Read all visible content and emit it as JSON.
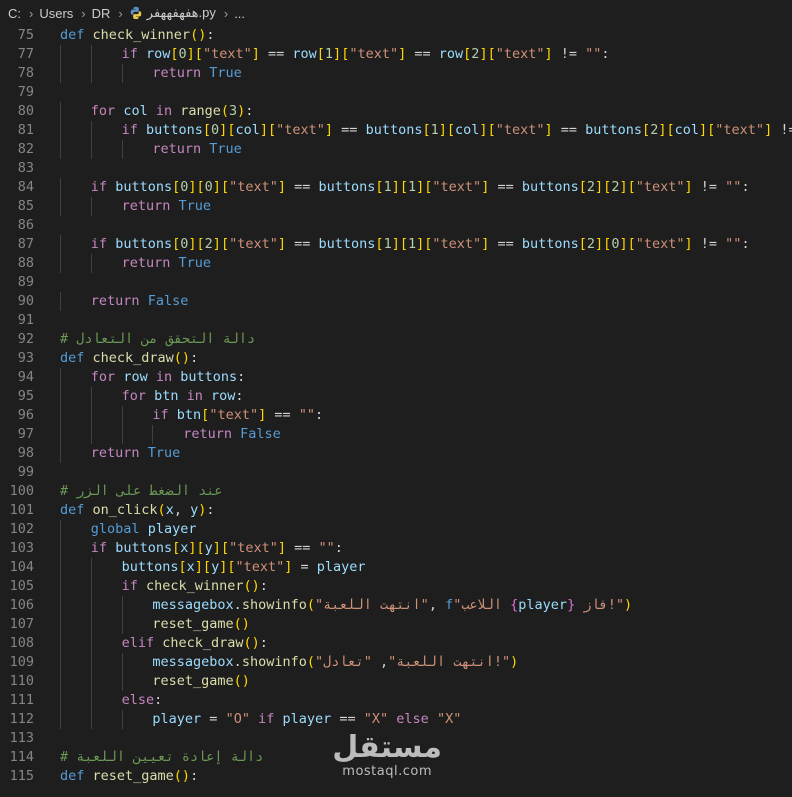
{
  "breadcrumb": {
    "items": [
      "C:",
      "Users",
      "DR"
    ],
    "file_icon": "python-file-icon",
    "file_name": "هفهفههفر.py",
    "trailing": "..."
  },
  "colors": {
    "background": "#1e1e1e",
    "keyword": "#569cd6",
    "control": "#c586c0",
    "function": "#dcdcaa",
    "variable": "#9cdcfe",
    "string": "#ce9178",
    "comment": "#6a9955",
    "line_number": "#858585"
  },
  "watermark": {
    "arabic": "مستقل",
    "latin": "mostaql.com"
  },
  "code_lines": [
    {
      "n": "75",
      "indent": 0,
      "tokens": [
        [
          "kw",
          "def "
        ],
        [
          "fn",
          "check_winner"
        ],
        [
          "b1",
          "()"
        ],
        [
          "p",
          ":"
        ]
      ]
    },
    {
      "n": "77",
      "indent": 2,
      "tokens": [
        [
          "ctl",
          "if "
        ],
        [
          "var",
          "row"
        ],
        [
          "b1",
          "["
        ],
        [
          "num",
          "0"
        ],
        [
          "b1",
          "]"
        ],
        [
          "b1",
          "["
        ],
        [
          "str",
          "\"text\""
        ],
        [
          "b1",
          "]"
        ],
        [
          "p",
          " == "
        ],
        [
          "var",
          "row"
        ],
        [
          "b1",
          "["
        ],
        [
          "num",
          "1"
        ],
        [
          "b1",
          "]"
        ],
        [
          "b1",
          "["
        ],
        [
          "str",
          "\"text\""
        ],
        [
          "b1",
          "]"
        ],
        [
          "p",
          " == "
        ],
        [
          "var",
          "row"
        ],
        [
          "b1",
          "["
        ],
        [
          "num",
          "2"
        ],
        [
          "b1",
          "]"
        ],
        [
          "b1",
          "["
        ],
        [
          "str",
          "\"text\""
        ],
        [
          "b1",
          "]"
        ],
        [
          "p",
          " != "
        ],
        [
          "str",
          "\"\""
        ],
        [
          "p",
          ":"
        ]
      ]
    },
    {
      "n": "78",
      "indent": 3,
      "tokens": [
        [
          "ctl",
          "return "
        ],
        [
          "kw",
          "True"
        ]
      ]
    },
    {
      "n": "79",
      "indent": 0,
      "tokens": []
    },
    {
      "n": "80",
      "indent": 1,
      "tokens": [
        [
          "ctl",
          "for "
        ],
        [
          "var",
          "col"
        ],
        [
          "ctl",
          " in "
        ],
        [
          "fn",
          "range"
        ],
        [
          "b1",
          "("
        ],
        [
          "num",
          "3"
        ],
        [
          "b1",
          ")"
        ],
        [
          "p",
          ":"
        ]
      ]
    },
    {
      "n": "81",
      "indent": 2,
      "tokens": [
        [
          "ctl",
          "if "
        ],
        [
          "var",
          "buttons"
        ],
        [
          "b1",
          "["
        ],
        [
          "num",
          "0"
        ],
        [
          "b1",
          "]"
        ],
        [
          "b1",
          "["
        ],
        [
          "var",
          "col"
        ],
        [
          "b1",
          "]"
        ],
        [
          "b1",
          "["
        ],
        [
          "str",
          "\"text\""
        ],
        [
          "b1",
          "]"
        ],
        [
          "p",
          " == "
        ],
        [
          "var",
          "buttons"
        ],
        [
          "b1",
          "["
        ],
        [
          "num",
          "1"
        ],
        [
          "b1",
          "]"
        ],
        [
          "b1",
          "["
        ],
        [
          "var",
          "col"
        ],
        [
          "b1",
          "]"
        ],
        [
          "b1",
          "["
        ],
        [
          "str",
          "\"text\""
        ],
        [
          "b1",
          "]"
        ],
        [
          "p",
          " == "
        ],
        [
          "var",
          "buttons"
        ],
        [
          "b1",
          "["
        ],
        [
          "num",
          "2"
        ],
        [
          "b1",
          "]"
        ],
        [
          "b1",
          "["
        ],
        [
          "var",
          "col"
        ],
        [
          "b1",
          "]"
        ],
        [
          "b1",
          "["
        ],
        [
          "str",
          "\"text\""
        ],
        [
          "b1",
          "]"
        ],
        [
          "p",
          " != "
        ],
        [
          "str",
          "\"\""
        ],
        [
          "p",
          ":"
        ]
      ]
    },
    {
      "n": "82",
      "indent": 3,
      "tokens": [
        [
          "ctl",
          "return "
        ],
        [
          "kw",
          "True"
        ]
      ]
    },
    {
      "n": "83",
      "indent": 0,
      "tokens": []
    },
    {
      "n": "84",
      "indent": 1,
      "tokens": [
        [
          "ctl",
          "if "
        ],
        [
          "var",
          "buttons"
        ],
        [
          "b1",
          "["
        ],
        [
          "num",
          "0"
        ],
        [
          "b1",
          "]"
        ],
        [
          "b1",
          "["
        ],
        [
          "num",
          "0"
        ],
        [
          "b1",
          "]"
        ],
        [
          "b1",
          "["
        ],
        [
          "str",
          "\"text\""
        ],
        [
          "b1",
          "]"
        ],
        [
          "p",
          " == "
        ],
        [
          "var",
          "buttons"
        ],
        [
          "b1",
          "["
        ],
        [
          "num",
          "1"
        ],
        [
          "b1",
          "]"
        ],
        [
          "b1",
          "["
        ],
        [
          "num",
          "1"
        ],
        [
          "b1",
          "]"
        ],
        [
          "b1",
          "["
        ],
        [
          "str",
          "\"text\""
        ],
        [
          "b1",
          "]"
        ],
        [
          "p",
          " == "
        ],
        [
          "var",
          "buttons"
        ],
        [
          "b1",
          "["
        ],
        [
          "num",
          "2"
        ],
        [
          "b1",
          "]"
        ],
        [
          "b1",
          "["
        ],
        [
          "num",
          "2"
        ],
        [
          "b1",
          "]"
        ],
        [
          "b1",
          "["
        ],
        [
          "str",
          "\"text\""
        ],
        [
          "b1",
          "]"
        ],
        [
          "p",
          " != "
        ],
        [
          "str",
          "\"\""
        ],
        [
          "p",
          ":"
        ]
      ]
    },
    {
      "n": "85",
      "indent": 2,
      "tokens": [
        [
          "ctl",
          "return "
        ],
        [
          "kw",
          "True"
        ]
      ]
    },
    {
      "n": "86",
      "indent": 0,
      "tokens": []
    },
    {
      "n": "87",
      "indent": 1,
      "tokens": [
        [
          "ctl",
          "if "
        ],
        [
          "var",
          "buttons"
        ],
        [
          "b1",
          "["
        ],
        [
          "num",
          "0"
        ],
        [
          "b1",
          "]"
        ],
        [
          "b1",
          "["
        ],
        [
          "num",
          "2"
        ],
        [
          "b1",
          "]"
        ],
        [
          "b1",
          "["
        ],
        [
          "str",
          "\"text\""
        ],
        [
          "b1",
          "]"
        ],
        [
          "p",
          " == "
        ],
        [
          "var",
          "buttons"
        ],
        [
          "b1",
          "["
        ],
        [
          "num",
          "1"
        ],
        [
          "b1",
          "]"
        ],
        [
          "b1",
          "["
        ],
        [
          "num",
          "1"
        ],
        [
          "b1",
          "]"
        ],
        [
          "b1",
          "["
        ],
        [
          "str",
          "\"text\""
        ],
        [
          "b1",
          "]"
        ],
        [
          "p",
          " == "
        ],
        [
          "var",
          "buttons"
        ],
        [
          "b1",
          "["
        ],
        [
          "num",
          "2"
        ],
        [
          "b1",
          "]"
        ],
        [
          "b1",
          "["
        ],
        [
          "num",
          "0"
        ],
        [
          "b1",
          "]"
        ],
        [
          "b1",
          "["
        ],
        [
          "str",
          "\"text\""
        ],
        [
          "b1",
          "]"
        ],
        [
          "p",
          " != "
        ],
        [
          "str",
          "\"\""
        ],
        [
          "p",
          ":"
        ]
      ]
    },
    {
      "n": "88",
      "indent": 2,
      "tokens": [
        [
          "ctl",
          "return "
        ],
        [
          "kw",
          "True"
        ]
      ]
    },
    {
      "n": "89",
      "indent": 0,
      "tokens": []
    },
    {
      "n": "90",
      "indent": 1,
      "tokens": [
        [
          "ctl",
          "return "
        ],
        [
          "kw",
          "False"
        ]
      ]
    },
    {
      "n": "91",
      "indent": 0,
      "tokens": []
    },
    {
      "n": "92",
      "indent": 0,
      "tokens": [
        [
          "cm",
          "# دالة التحقق من التعادل"
        ]
      ]
    },
    {
      "n": "93",
      "indent": 0,
      "tokens": [
        [
          "kw",
          "def "
        ],
        [
          "fn",
          "check_draw"
        ],
        [
          "b1",
          "()"
        ],
        [
          "p",
          ":"
        ]
      ]
    },
    {
      "n": "94",
      "indent": 1,
      "tokens": [
        [
          "ctl",
          "for "
        ],
        [
          "var",
          "row"
        ],
        [
          "ctl",
          " in "
        ],
        [
          "var",
          "buttons"
        ],
        [
          "p",
          ":"
        ]
      ]
    },
    {
      "n": "95",
      "indent": 2,
      "tokens": [
        [
          "ctl",
          "for "
        ],
        [
          "var",
          "btn"
        ],
        [
          "ctl",
          " in "
        ],
        [
          "var",
          "row"
        ],
        [
          "p",
          ":"
        ]
      ]
    },
    {
      "n": "96",
      "indent": 3,
      "tokens": [
        [
          "ctl",
          "if "
        ],
        [
          "var",
          "btn"
        ],
        [
          "b1",
          "["
        ],
        [
          "str",
          "\"text\""
        ],
        [
          "b1",
          "]"
        ],
        [
          "p",
          " == "
        ],
        [
          "str",
          "\"\""
        ],
        [
          "p",
          ":"
        ]
      ]
    },
    {
      "n": "97",
      "indent": 4,
      "tokens": [
        [
          "ctl",
          "return "
        ],
        [
          "kw",
          "False"
        ]
      ]
    },
    {
      "n": "98",
      "indent": 1,
      "tokens": [
        [
          "ctl",
          "return "
        ],
        [
          "kw",
          "True"
        ]
      ]
    },
    {
      "n": "99",
      "indent": 0,
      "tokens": []
    },
    {
      "n": "100",
      "indent": 0,
      "tokens": [
        [
          "cm",
          "# عند الضغط على الزر"
        ]
      ]
    },
    {
      "n": "101",
      "indent": 0,
      "tokens": [
        [
          "kw",
          "def "
        ],
        [
          "fn",
          "on_click"
        ],
        [
          "b1",
          "("
        ],
        [
          "var",
          "x"
        ],
        [
          "p",
          ", "
        ],
        [
          "var",
          "y"
        ],
        [
          "b1",
          ")"
        ],
        [
          "p",
          ":"
        ]
      ]
    },
    {
      "n": "102",
      "indent": 1,
      "tokens": [
        [
          "kw",
          "global "
        ],
        [
          "var",
          "player"
        ]
      ]
    },
    {
      "n": "103",
      "indent": 1,
      "tokens": [
        [
          "ctl",
          "if "
        ],
        [
          "var",
          "buttons"
        ],
        [
          "b1",
          "["
        ],
        [
          "var",
          "x"
        ],
        [
          "b1",
          "]"
        ],
        [
          "b1",
          "["
        ],
        [
          "var",
          "y"
        ],
        [
          "b1",
          "]"
        ],
        [
          "b1",
          "["
        ],
        [
          "str",
          "\"text\""
        ],
        [
          "b1",
          "]"
        ],
        [
          "p",
          " == "
        ],
        [
          "str",
          "\"\""
        ],
        [
          "p",
          ":"
        ]
      ]
    },
    {
      "n": "104",
      "indent": 2,
      "tokens": [
        [
          "var",
          "buttons"
        ],
        [
          "b1",
          "["
        ],
        [
          "var",
          "x"
        ],
        [
          "b1",
          "]"
        ],
        [
          "b1",
          "["
        ],
        [
          "var",
          "y"
        ],
        [
          "b1",
          "]"
        ],
        [
          "b1",
          "["
        ],
        [
          "str",
          "\"text\""
        ],
        [
          "b1",
          "]"
        ],
        [
          "p",
          " = "
        ],
        [
          "var",
          "player"
        ]
      ]
    },
    {
      "n": "105",
      "indent": 2,
      "tokens": [
        [
          "ctl",
          "if "
        ],
        [
          "fn",
          "check_winner"
        ],
        [
          "b1",
          "()"
        ],
        [
          "p",
          ":"
        ]
      ]
    },
    {
      "n": "106",
      "indent": 3,
      "tokens": [
        [
          "var",
          "messagebox"
        ],
        [
          "p",
          "."
        ],
        [
          "fn",
          "showinfo"
        ],
        [
          "b1",
          "("
        ],
        [
          "str",
          "\"انتهت اللعبة\""
        ],
        [
          "p",
          ", "
        ],
        [
          "kw",
          "f"
        ],
        [
          "str",
          "\"اللاعب "
        ],
        [
          "b2",
          "{"
        ],
        [
          "var",
          "player"
        ],
        [
          "b2",
          "}"
        ],
        [
          "str",
          " فاز!\""
        ],
        [
          "b1",
          ")"
        ]
      ]
    },
    {
      "n": "107",
      "indent": 3,
      "tokens": [
        [
          "fn",
          "reset_game"
        ],
        [
          "b1",
          "()"
        ]
      ]
    },
    {
      "n": "108",
      "indent": 2,
      "tokens": [
        [
          "ctl",
          "elif "
        ],
        [
          "fn",
          "check_draw"
        ],
        [
          "b1",
          "()"
        ],
        [
          "p",
          ":"
        ]
      ]
    },
    {
      "n": "109",
      "indent": 3,
      "tokens": [
        [
          "var",
          "messagebox"
        ],
        [
          "p",
          "."
        ],
        [
          "fn",
          "showinfo"
        ],
        [
          "b1",
          "("
        ],
        [
          "str",
          "\"انتهت اللعبة\""
        ],
        [
          "p",
          ", "
        ],
        [
          "str",
          "\"تعادل!\""
        ],
        [
          "b1",
          ")"
        ]
      ]
    },
    {
      "n": "110",
      "indent": 3,
      "tokens": [
        [
          "fn",
          "reset_game"
        ],
        [
          "b1",
          "()"
        ]
      ]
    },
    {
      "n": "111",
      "indent": 2,
      "tokens": [
        [
          "ctl",
          "else"
        ],
        [
          "p",
          ":"
        ]
      ]
    },
    {
      "n": "112",
      "indent": 3,
      "tokens": [
        [
          "var",
          "player"
        ],
        [
          "p",
          " = "
        ],
        [
          "str",
          "\"O\""
        ],
        [
          "ctl",
          " if "
        ],
        [
          "var",
          "player"
        ],
        [
          "p",
          " == "
        ],
        [
          "str",
          "\"X\""
        ],
        [
          "ctl",
          " else "
        ],
        [
          "str",
          "\"X\""
        ]
      ]
    },
    {
      "n": "113",
      "indent": 0,
      "tokens": []
    },
    {
      "n": "114",
      "indent": 0,
      "tokens": [
        [
          "cm",
          "# دالة إعادة تعيين اللعبة"
        ]
      ]
    },
    {
      "n": "115",
      "indent": 0,
      "tokens": [
        [
          "kw",
          "def "
        ],
        [
          "fn",
          "reset_game"
        ],
        [
          "b1",
          "()"
        ],
        [
          "p",
          ":"
        ]
      ]
    }
  ]
}
